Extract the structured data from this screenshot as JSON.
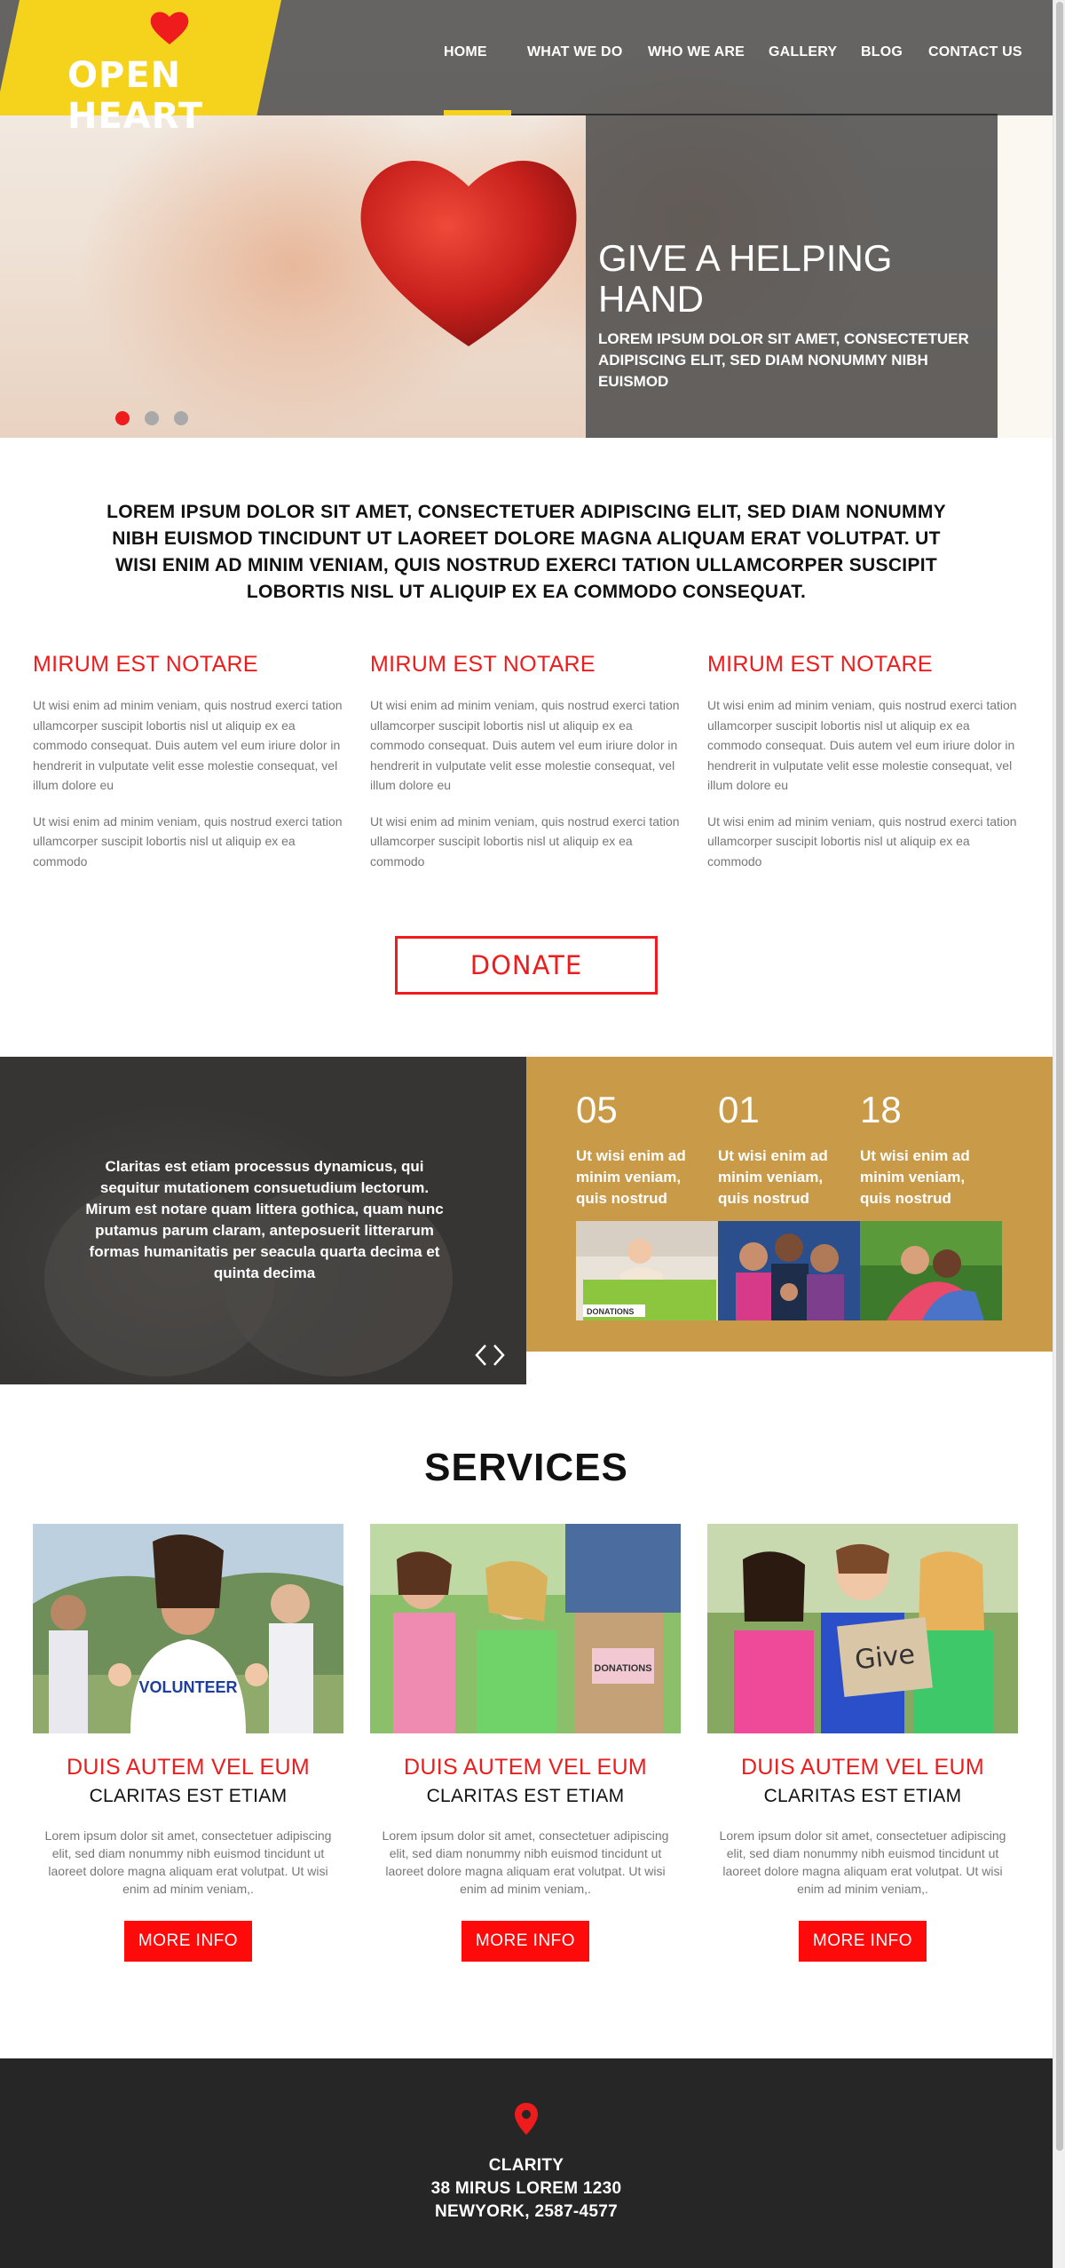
{
  "brand": {
    "name": "OPEN HEART",
    "logo_icon": "heart-icon",
    "color_yellow": "#f5d31c",
    "color_red": "#ee1c1c"
  },
  "nav": {
    "items": [
      {
        "label": "HOME",
        "active": true
      },
      {
        "label": "WHAT WE DO",
        "active": false
      },
      {
        "label": "WHO WE ARE",
        "active": false
      },
      {
        "label": "GALLERY",
        "active": false
      },
      {
        "label": "BLOG",
        "active": false
      },
      {
        "label": "CONTACT US",
        "active": false
      }
    ]
  },
  "hero": {
    "title": "GIVE A HELPING HAND",
    "subtitle": "LOREM IPSUM DOLOR SIT AMET, CONSECTETUER ADIPISCING ELIT, SED DIAM NONUMMY NIBH EUISMOD",
    "slides": 3,
    "active_slide": 1
  },
  "intro": {
    "text": "LOREM IPSUM DOLOR SIT AMET, CONSECTETUER ADIPISCING ELIT, SED DIAM NONUMMY NIBH EUISMOD TINCIDUNT UT LAOREET DOLORE MAGNA ALIQUAM ERAT VOLUTPAT. UT WISI ENIM AD MINIM VENIAM, QUIS NOSTRUD EXERCI TATION ULLAMCORPER SUSCIPIT LOBORTIS NISL UT ALIQUIP EX EA COMMODO CONSEQUAT."
  },
  "columns": [
    {
      "title": "MIRUM EST NOTARE",
      "p1": "Ut wisi enim ad minim veniam, quis nostrud exerci tation ullamcorper suscipit lobortis nisl ut aliquip ex ea commodo consequat. Duis autem vel eum iriure dolor in hendrerit in vulputate velit esse molestie consequat, vel illum dolore eu",
      "p2": "Ut wisi enim ad minim veniam, quis nostrud exerci tation ullamcorper suscipit lobortis nisl ut aliquip ex ea commodo"
    },
    {
      "title": "MIRUM EST NOTARE",
      "p1": "Ut wisi enim ad minim veniam, quis nostrud exerci tation ullamcorper suscipit lobortis nisl ut aliquip ex ea commodo consequat. Duis autem vel eum iriure dolor in hendrerit in vulputate velit esse molestie consequat, vel illum dolore eu",
      "p2": "Ut wisi enim ad minim veniam, quis nostrud exerci tation ullamcorper suscipit lobortis nisl ut aliquip ex ea commodo"
    },
    {
      "title": "MIRUM EST NOTARE",
      "p1": "Ut wisi enim ad minim veniam, quis nostrud exerci tation ullamcorper suscipit lobortis nisl ut aliquip ex ea commodo consequat. Duis autem vel eum iriure dolor in hendrerit in vulputate velit esse molestie consequat, vel illum dolore eu",
      "p2": "Ut wisi enim ad minim veniam, quis nostrud exerci tation ullamcorper suscipit lobortis nisl ut aliquip ex ea commodo"
    }
  ],
  "donate": {
    "label": "DONATE"
  },
  "testimonial": {
    "quote": "Claritas est etiam processus dynamicus, qui sequitur mutationem consuetudium lectorum. Mirum est notare quam littera gothica, quam nunc putamus parum claram, anteposuerit litterarum formas humanitatis per seacula quarta decima et quinta decima",
    "prev_icon": "chevron-left-icon",
    "next_icon": "chevron-right-icon"
  },
  "stats": {
    "background": "#c99a48",
    "items": [
      {
        "number": "05",
        "text": "Ut wisi enim ad minim veniam, quis nostrud",
        "image_label": "DONATIONS"
      },
      {
        "number": "01",
        "text": "Ut wisi enim ad minim veniam, quis nostrud"
      },
      {
        "number": "18",
        "text": "Ut wisi enim ad minim veniam, quis nostrud"
      }
    ]
  },
  "services": {
    "title": "SERVICES",
    "items": [
      {
        "title": "DUIS AUTEM VEL EUM",
        "subtitle": "CLARITAS EST ETIAM",
        "text": "Lorem ipsum dolor sit amet, consectetuer adipiscing elit, sed diam nonummy nibh euismod tincidunt ut laoreet dolore magna aliquam erat volutpat. Ut wisi enim ad minim veniam,.",
        "button": "MORE INFO",
        "image_label": "VOLUNTEER"
      },
      {
        "title": "DUIS AUTEM VEL EUM",
        "subtitle": "CLARITAS EST ETIAM",
        "text": "Lorem ipsum dolor sit amet, consectetuer adipiscing elit, sed diam nonummy nibh euismod tincidunt ut laoreet dolore magna aliquam erat volutpat. Ut wisi enim ad minim veniam,.",
        "button": "MORE INFO",
        "image_label": "DONATIONS"
      },
      {
        "title": "DUIS AUTEM VEL EUM",
        "subtitle": "CLARITAS EST ETIAM",
        "text": "Lorem ipsum dolor sit amet, consectetuer adipiscing elit, sed diam nonummy nibh euismod tincidunt ut laoreet dolore magna aliquam erat volutpat. Ut wisi enim ad minim veniam,.",
        "button": "MORE INFO",
        "image_label": "Give"
      }
    ]
  },
  "footer": {
    "icon": "map-pin-icon",
    "line1": "CLARITY",
    "line2": "38 MIRUS LOREM 1230",
    "line3": "NEWYORK, 2587-4577"
  }
}
